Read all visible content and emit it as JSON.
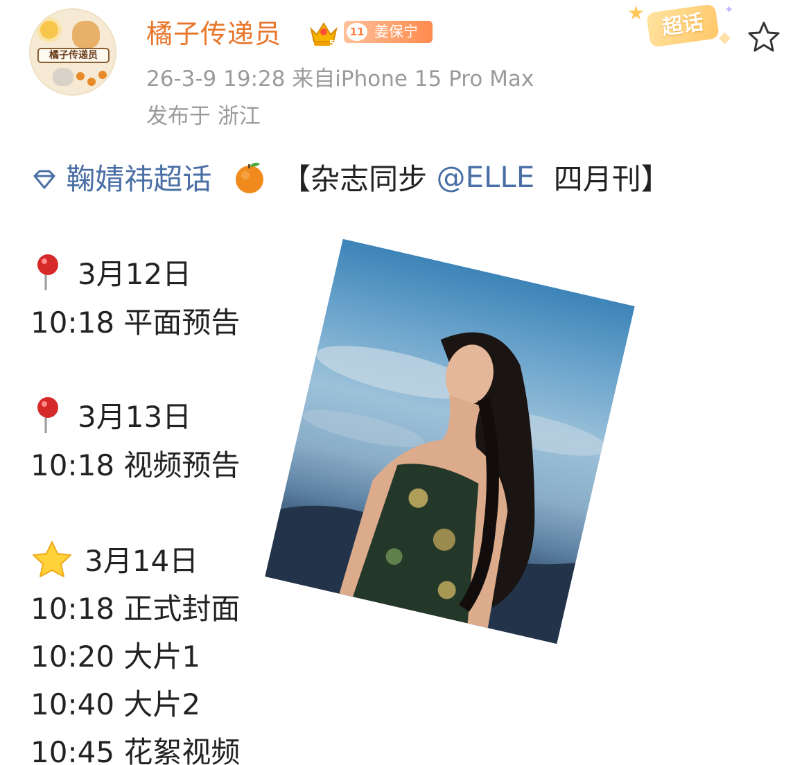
{
  "post": {
    "author": {
      "name": "橘子传递员",
      "avatar_plate_text": "橘子传递员",
      "fan_badge": {
        "level": "11",
        "name": "姜保宁"
      }
    },
    "time_source": "26-3-9 19:28 来自iPhone 15 Pro Max",
    "location": "发布于 浙江",
    "chaohua_badge": "超话",
    "topic_line": {
      "topic": "鞠婧祎超话",
      "text_open": "【杂志同步",
      "mention": "@ELLE",
      "text_close": "四月刊】"
    },
    "schedule": [
      {
        "icon": "pin",
        "text": "3月12日"
      },
      {
        "icon": "none",
        "text": "10:18 平面预告"
      },
      {
        "icon": "pin",
        "text": "3月13日"
      },
      {
        "icon": "none",
        "text": "10:18 视频预告"
      },
      {
        "icon": "star",
        "text": "3月14日"
      },
      {
        "icon": "none",
        "text": "10:18 正式封面"
      },
      {
        "icon": "none",
        "text": "10:20 大片1"
      },
      {
        "icon": "none",
        "text": "10:40 大片2"
      },
      {
        "icon": "none",
        "text": "10:45 花絮视频"
      }
    ]
  },
  "colors": {
    "username": "#e8762b",
    "link": "#4a6fa5",
    "meta": "#9a9a9a",
    "text": "#222222"
  }
}
